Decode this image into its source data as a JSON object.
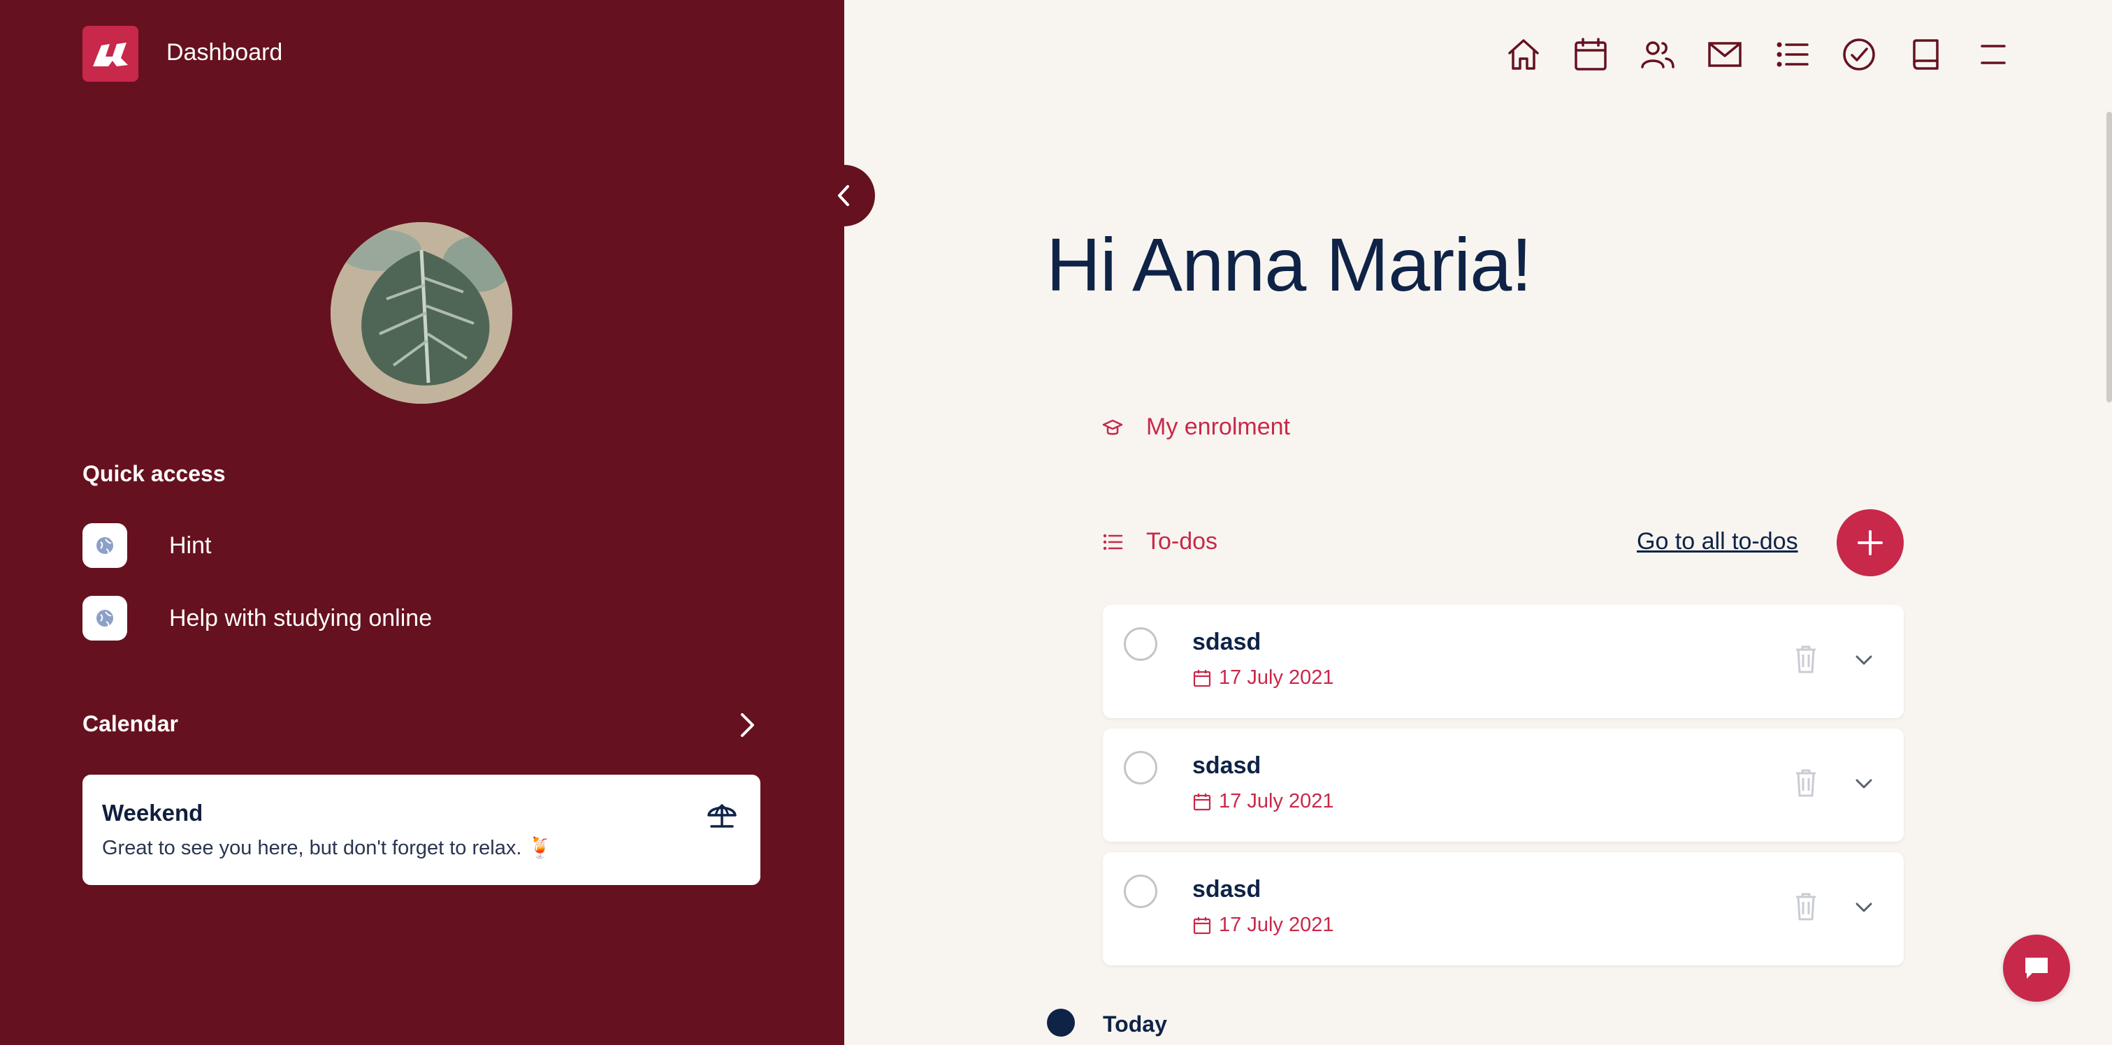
{
  "app": {
    "title": "Dashboard"
  },
  "colors": {
    "sidebar": "#66111f",
    "accent": "#c8284a",
    "navy": "#0f2347",
    "background": "#f8f5f0"
  },
  "nav": {
    "icons": [
      "home-icon",
      "calendar-icon",
      "people-icon",
      "mail-icon",
      "list-icon",
      "check-circle-icon",
      "book-icon",
      "menu-icon"
    ]
  },
  "sidebar": {
    "quick_access_title": "Quick access",
    "quick_access": [
      {
        "label": "Hint",
        "icon": "globe-icon"
      },
      {
        "label": "Help with studying online",
        "icon": "globe-icon"
      }
    ],
    "calendar_title": "Calendar",
    "event": {
      "title": "Weekend",
      "text": "Great to see you here, but don't forget to relax. 🍹",
      "icon": "beach-umbrella-icon"
    }
  },
  "main": {
    "greeting": "Hi Anna Maria!",
    "enrolment_label": "My enrolment",
    "todos_label": "To-dos",
    "all_todos_link": "Go to all to-dos",
    "todos": [
      {
        "title": "sdasd",
        "date": "17 July 2021"
      },
      {
        "title": "sdasd",
        "date": "17 July 2021"
      },
      {
        "title": "sdasd",
        "date": "17 July 2021"
      }
    ],
    "today_label": "Today"
  }
}
